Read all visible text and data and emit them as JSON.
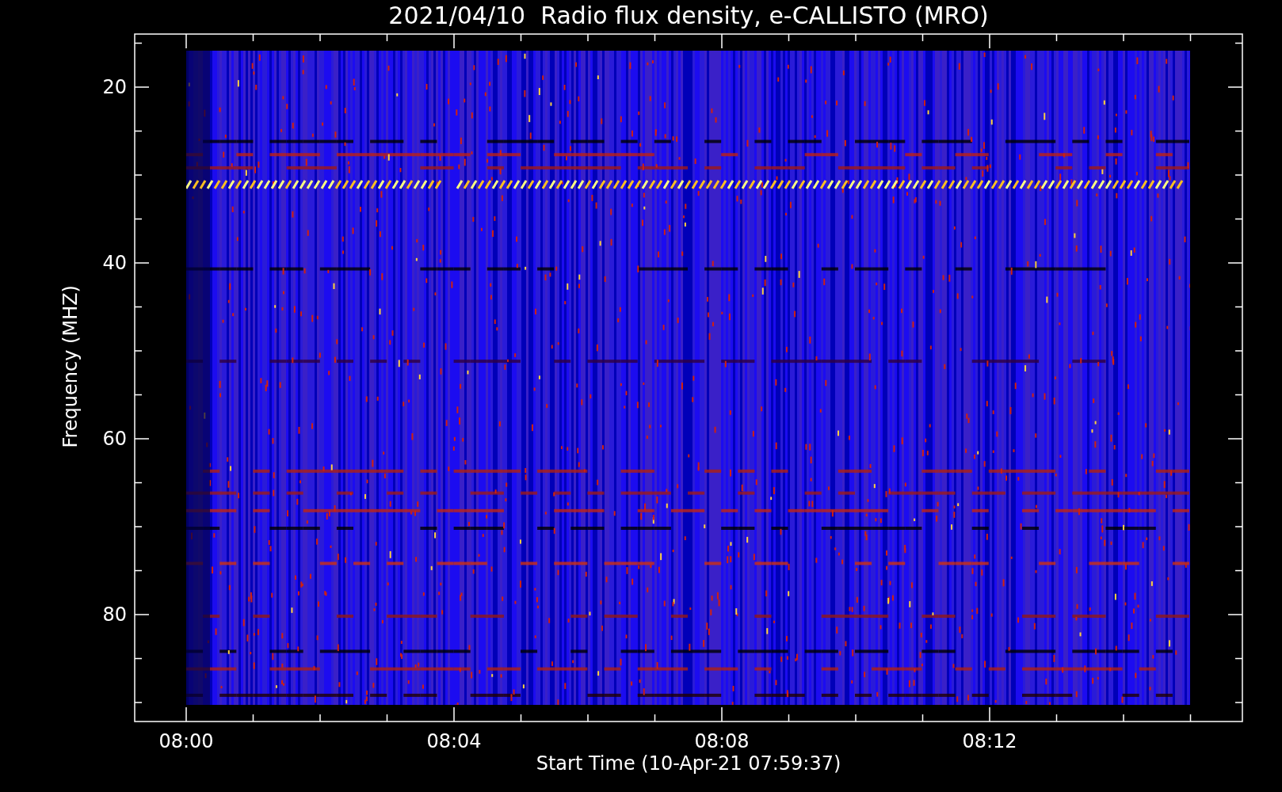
{
  "title": "2021/04/10  Radio flux density, e-CALLISTO (MRO)",
  "y_axis": {
    "label": "Frequency (MHZ)",
    "ticks": [
      "20",
      "40",
      "60",
      "80"
    ]
  },
  "x_axis": {
    "label": "Start Time (10-Apr-21 07:59:37)",
    "ticks": [
      "08:00",
      "08:04",
      "08:08",
      "08:12"
    ]
  }
}
